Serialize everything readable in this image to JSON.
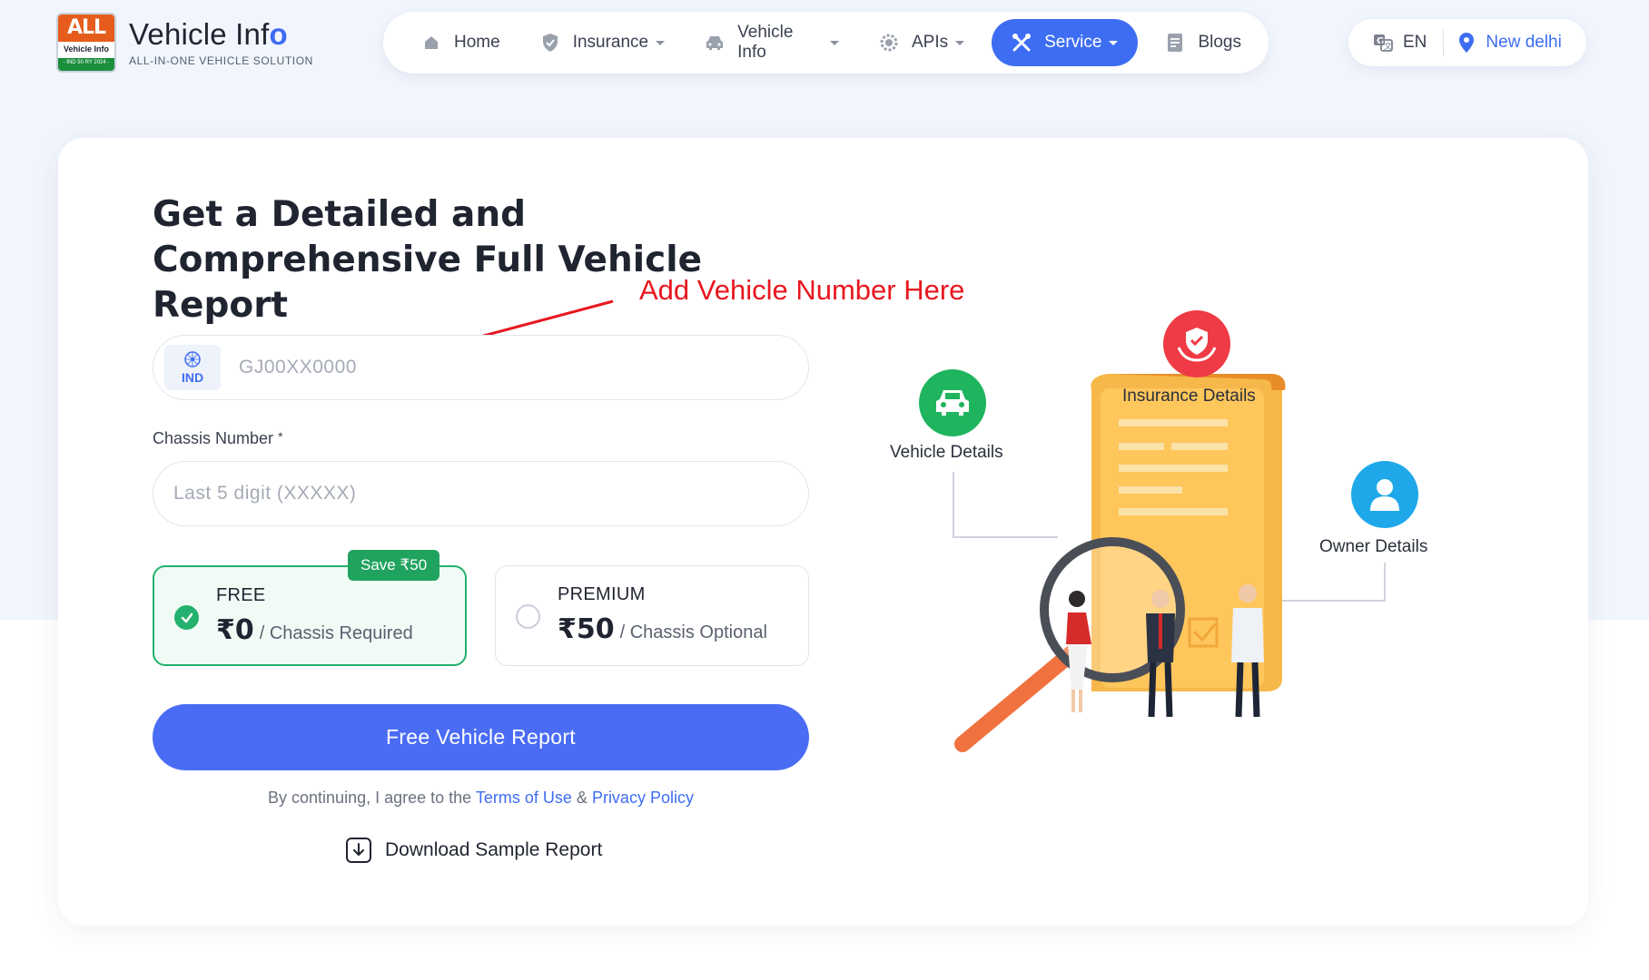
{
  "brand": {
    "badge_top": "ALL",
    "badge_mid": "Vehicle Info",
    "badge_bottom": "- IND 50 RY 2024 -",
    "title": "Vehicle Inf",
    "title_accent": "o",
    "tagline": "ALL-IN-ONE VEHICLE SOLUTION"
  },
  "nav": {
    "items": [
      {
        "label": "Home",
        "icon": "home-icon",
        "dropdown": false
      },
      {
        "label": "Insurance",
        "icon": "shield-icon",
        "dropdown": true
      },
      {
        "label": "Vehicle Info",
        "icon": "car-icon",
        "dropdown": true
      },
      {
        "label": "APIs",
        "icon": "chip-icon",
        "dropdown": true
      },
      {
        "label": "Service",
        "icon": "tools-icon",
        "dropdown": true,
        "active": true
      },
      {
        "label": "Blogs",
        "icon": "document-icon",
        "dropdown": false
      }
    ]
  },
  "locale": {
    "language": "EN",
    "city": "New delhi"
  },
  "hero": {
    "headline": "Get a Detailed and Comprehensive Full Vehicle Report",
    "annotation": "Add Vehicle Number Here"
  },
  "form": {
    "country_code": "IND",
    "vehicle_number_placeholder": "GJ00XX0000",
    "vehicle_number_value": "",
    "chassis_label": "Chassis Number",
    "chassis_required_mark": "*",
    "chassis_placeholder": "Last 5 digit (XXXXX)",
    "chassis_value": ""
  },
  "plans": {
    "free": {
      "name": "FREE",
      "price": "₹0",
      "note": "/ Chassis Required",
      "badge": "Save ₹50",
      "selected": true
    },
    "premium": {
      "name": "PREMIUM",
      "price": "₹50",
      "note": "/ Chassis Optional",
      "selected": false
    }
  },
  "cta": {
    "label": "Free Vehicle Report"
  },
  "consent": {
    "prefix": "By continuing, I agree to the",
    "terms": "Terms of Use",
    "and": "&",
    "privacy": "Privacy Policy"
  },
  "download": {
    "label": "Download Sample Report"
  },
  "illustration": {
    "features": [
      {
        "label": "Vehicle Details",
        "color": "#1fb45e",
        "icon": "car-icon"
      },
      {
        "label": "Insurance Details",
        "color": "#ef3b45",
        "icon": "insurance-hands-icon"
      },
      {
        "label": "Owner Details",
        "color": "#1ea8ea",
        "icon": "user-icon"
      }
    ]
  },
  "colors": {
    "primary": "#3d6df2",
    "success": "#23b26d",
    "annotation": "#e8171f"
  }
}
